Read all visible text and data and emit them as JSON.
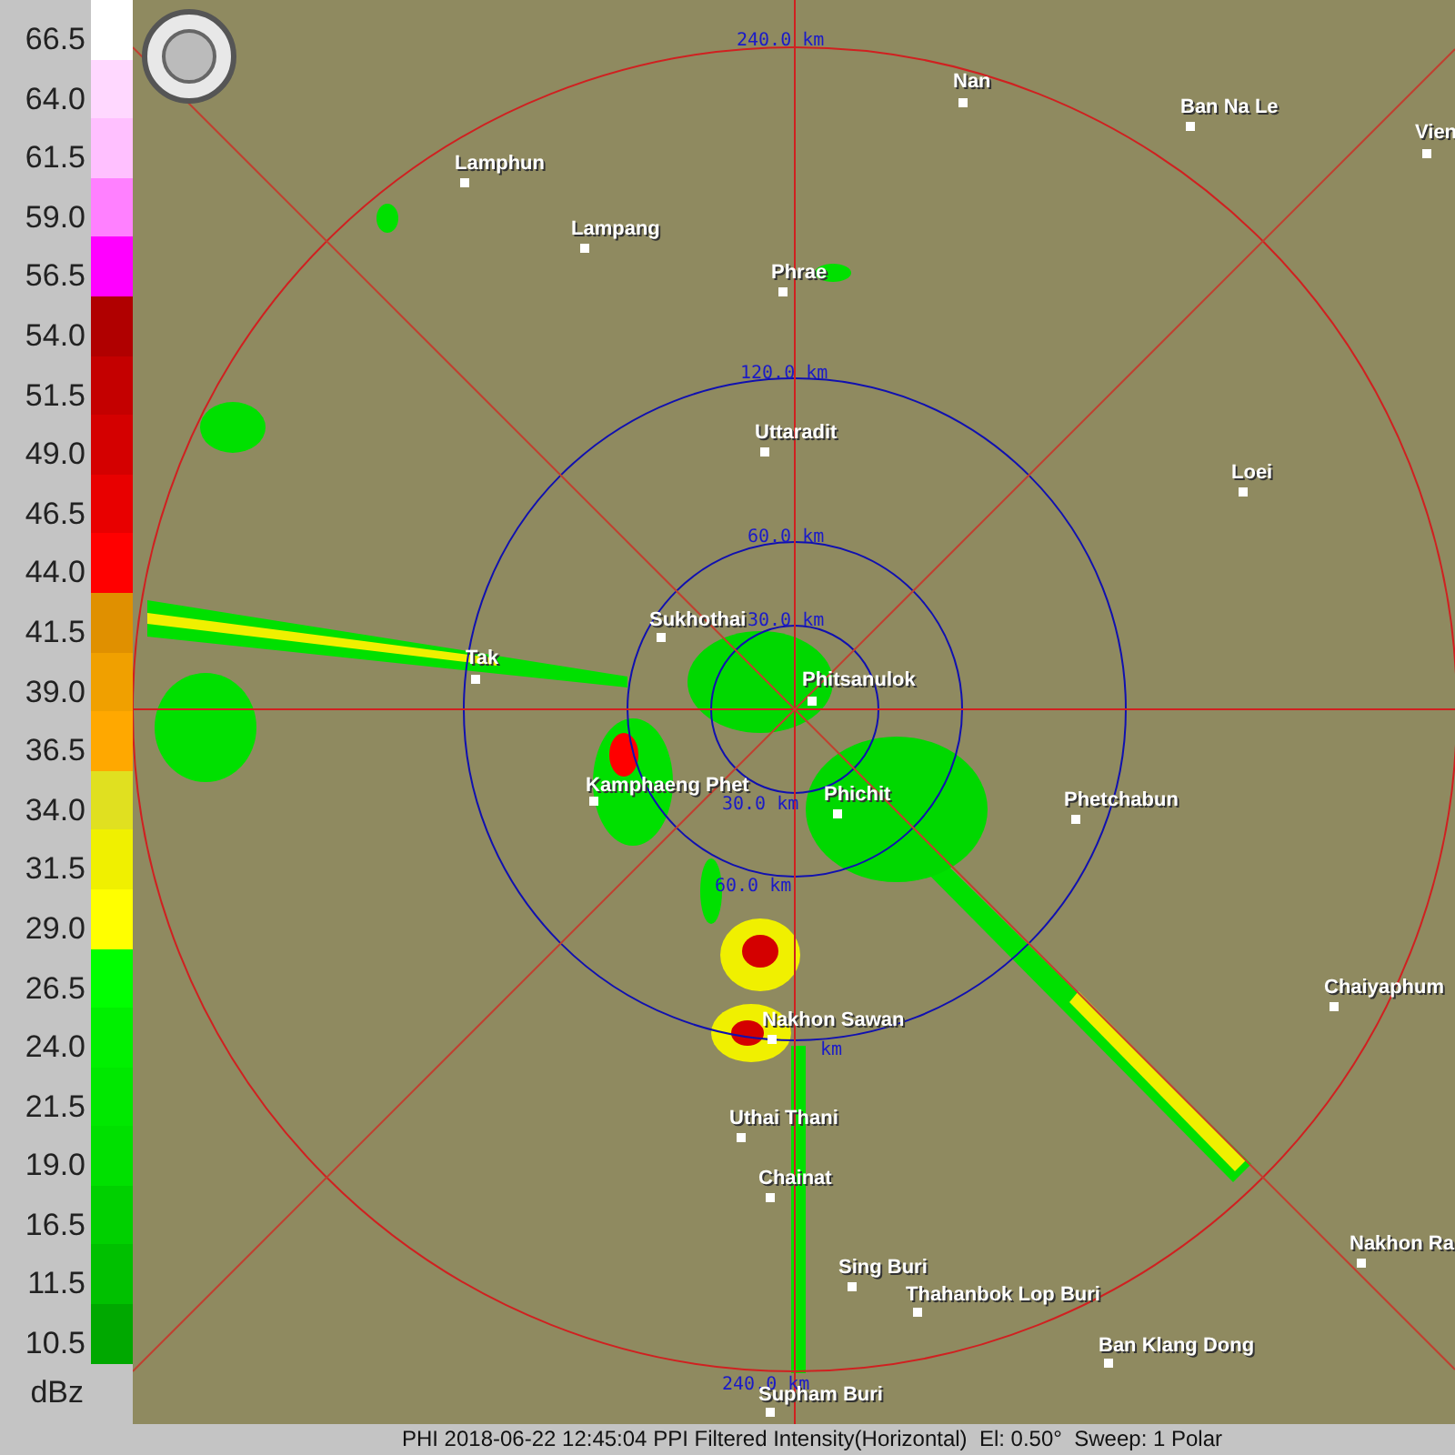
{
  "legend": {
    "unit": "dBz",
    "items": [
      {
        "label": "66.5",
        "color": "#ffffff"
      },
      {
        "label": "64.0",
        "color": "#ffd8ff"
      },
      {
        "label": "61.5",
        "color": "#ffc0ff"
      },
      {
        "label": "59.0",
        "color": "#ff80ff"
      },
      {
        "label": "56.5",
        "color": "#ff00ff"
      },
      {
        "label": "54.0",
        "color": "#b00000"
      },
      {
        "label": "51.5",
        "color": "#c40000"
      },
      {
        "label": "49.0",
        "color": "#d40000"
      },
      {
        "label": "46.5",
        "color": "#e80000"
      },
      {
        "label": "44.0",
        "color": "#ff0000"
      },
      {
        "label": "41.5",
        "color": "#e09000"
      },
      {
        "label": "39.0",
        "color": "#f0a000"
      },
      {
        "label": "36.5",
        "color": "#ffa800"
      },
      {
        "label": "34.0",
        "color": "#e0e020"
      },
      {
        "label": "31.5",
        "color": "#f0f000"
      },
      {
        "label": "29.0",
        "color": "#ffff00"
      },
      {
        "label": "26.5",
        "color": "#00ff00"
      },
      {
        "label": "24.0",
        "color": "#00f000"
      },
      {
        "label": "21.5",
        "color": "#00e800"
      },
      {
        "label": "19.0",
        "color": "#00e000"
      },
      {
        "label": "16.5",
        "color": "#00d000"
      },
      {
        "label": "11.5",
        "color": "#00c000"
      },
      {
        "label": "10.5",
        "color": "#00a800"
      }
    ]
  },
  "range_labels": [
    {
      "text": "240.0 km"
    },
    {
      "text": "120.0 km"
    },
    {
      "text": "60.0 km"
    },
    {
      "text": "30.0 km"
    },
    {
      "text": "30.0 km"
    },
    {
      "text": "60.0 km"
    },
    {
      "text": "km"
    },
    {
      "text": "240.0 km"
    }
  ],
  "cities": [
    {
      "name": "Lamphun"
    },
    {
      "name": "Lampang"
    },
    {
      "name": "Nan"
    },
    {
      "name": "Ban Na Le"
    },
    {
      "name": "Vien"
    },
    {
      "name": "Phrae"
    },
    {
      "name": "Uttaradit"
    },
    {
      "name": "Loei"
    },
    {
      "name": "Sukhothai"
    },
    {
      "name": "Phitsanulok"
    },
    {
      "name": "Tak"
    },
    {
      "name": "Kamphaeng Phet"
    },
    {
      "name": "Phichit"
    },
    {
      "name": "Phetchabun"
    },
    {
      "name": "Chaiyaphum"
    },
    {
      "name": "Nakhon Sawan"
    },
    {
      "name": "Uthai Thani"
    },
    {
      "name": "Chainat"
    },
    {
      "name": "Nakhon Ra"
    },
    {
      "name": "Sing Buri"
    },
    {
      "name": "Thahanbok Lop Buri"
    },
    {
      "name": "Ban Klang Dong"
    },
    {
      "name": "Supham Buri"
    }
  ],
  "footer": "PHI 2018-06-22 12:45:04 PPI Filtered Intensity(Horizontal)  El: 0.50°  Sweep: 1 Polar"
}
